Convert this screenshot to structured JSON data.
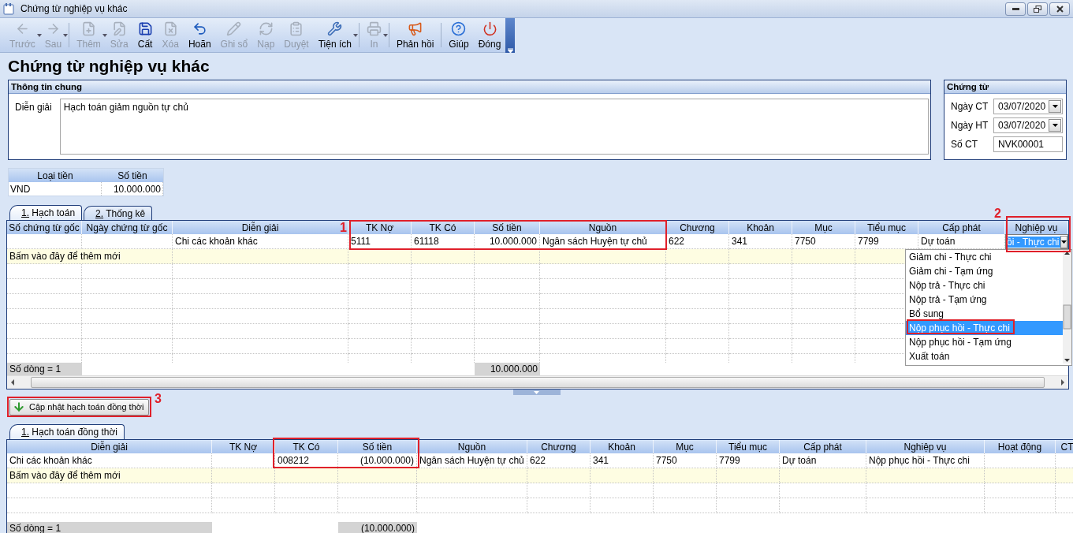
{
  "window": {
    "title": "Chứng từ nghiệp vụ khác"
  },
  "toolbar": [
    {
      "label": "Trước",
      "disabled": true,
      "dropdown": true,
      "group_end": false
    },
    {
      "label": "Sau",
      "disabled": true,
      "dropdown": true,
      "group_end": true
    },
    {
      "label": "Thêm",
      "disabled": true,
      "dropdown": true,
      "group_end": false
    },
    {
      "label": "Sửa",
      "disabled": true,
      "dropdown": false,
      "group_end": false
    },
    {
      "label": "Cất",
      "disabled": false,
      "dropdown": false,
      "group_end": false
    },
    {
      "label": "Xóa",
      "disabled": true,
      "dropdown": false,
      "group_end": false
    },
    {
      "label": "Hoãn",
      "disabled": false,
      "dropdown": false,
      "group_end": false
    },
    {
      "label": "Ghi sổ",
      "disabled": true,
      "dropdown": false,
      "group_end": false
    },
    {
      "label": "Nạp",
      "disabled": true,
      "dropdown": false,
      "group_end": false
    },
    {
      "label": "Duyệt",
      "disabled": true,
      "dropdown": false,
      "group_end": false
    },
    {
      "label": "Tiện ích",
      "disabled": false,
      "dropdown": true,
      "group_end": true
    },
    {
      "label": "In",
      "disabled": true,
      "dropdown": true,
      "group_end": true
    },
    {
      "label": "Phản hồi",
      "disabled": false,
      "dropdown": false,
      "group_end": true
    },
    {
      "label": "Giúp",
      "disabled": false,
      "dropdown": false,
      "group_end": false
    },
    {
      "label": "Đóng",
      "disabled": false,
      "dropdown": false,
      "group_end": false
    }
  ],
  "page_title": "Chứng từ nghiệp vụ khác",
  "general_info": {
    "title": "Thông tin chung",
    "label": "Diễn giải",
    "value": "Hạch toán giảm nguồn tự chủ"
  },
  "voucher": {
    "title": "Chứng từ",
    "fields": [
      {
        "label": "Ngày CT",
        "value": "03/07/2020",
        "kind": "date"
      },
      {
        "label": "Ngày HT",
        "value": "03/07/2020",
        "kind": "date"
      },
      {
        "label": "Số CT",
        "value": "NVK00001",
        "kind": "text"
      }
    ]
  },
  "currency": {
    "columns": [
      "Loại tiền",
      "Số tiền"
    ],
    "rows": [
      [
        "VND",
        "10.000.000"
      ]
    ]
  },
  "tabs": [
    {
      "label": "1. Hạch toán",
      "selected": true
    },
    {
      "label": "2. Thống kê",
      "selected": false
    }
  ],
  "entries": {
    "columns": [
      "Số chứng từ gốc",
      "Ngày chứng từ gốc",
      "Diễn giải",
      "TK Nợ",
      "TK Có",
      "Số tiền",
      "Nguồn",
      "Chương",
      "Khoản",
      "Mục",
      "Tiểu mục",
      "Cấp phát",
      "Nghiệp vụ"
    ],
    "rows": [
      [
        null,
        null,
        "Chi các khoản khác",
        "5111",
        "61118",
        "10.000.000",
        "Ngân sách Huyện tự chủ",
        "622",
        "341",
        "7750",
        "7799",
        "Dự toán",
        {
          "kind": "combo",
          "value": "ồi - Thực chi"
        }
      ]
    ],
    "new_row": "Bấm vào đây để thêm mới",
    "footer": {
      "count": "Số dòng = 1",
      "total": "10.000.000"
    }
  },
  "dropdown": {
    "items": [
      {
        "label": "Giảm chi - Thực chi",
        "selected": false
      },
      {
        "label": "Giảm chi - Tạm ứng",
        "selected": false
      },
      {
        "label": "Nộp trả - Thực chi",
        "selected": false
      },
      {
        "label": "Nộp trả - Tạm ứng",
        "selected": false
      },
      {
        "label": "Bổ sung",
        "selected": false
      },
      {
        "label": "Nộp phục hồi - Thực chi",
        "selected": true
      },
      {
        "label": "Nộp phục hồi - Tạm ứng",
        "selected": false
      },
      {
        "label": "Xuất toán",
        "selected": false
      }
    ]
  },
  "update_button": {
    "label": "Cập nhật hạch toán đồng thời"
  },
  "lower_tabs": [
    {
      "label": "1. Hạch toán đồng thời",
      "selected": true
    }
  ],
  "concurrent": {
    "columns": [
      "Diễn giải",
      "TK Nợ",
      "TK Có",
      "Số tiền",
      "Nguồn",
      "Chương",
      "Khoản",
      "Mục",
      "Tiểu mục",
      "Cấp phát",
      "Nghiệp vụ",
      "Hoạt động",
      "CT"
    ],
    "rows": [
      [
        "Chi các khoản khác",
        null,
        "008212",
        "(10.000.000)",
        "Ngân sách Huyện tự chủ",
        "622",
        "341",
        "7750",
        "7799",
        "Dự toán",
        "Nộp phục hồi - Thực chi",
        null,
        null
      ]
    ],
    "new_row": "Bấm vào đây để thêm mới",
    "footer": {
      "count": "Số dòng = 1",
      "total": "(10.000.000)"
    }
  },
  "annotations": [
    {
      "kind": "numbered",
      "label": "1"
    },
    {
      "kind": "numbered",
      "label": "2"
    },
    {
      "kind": "numbered",
      "label": "3"
    },
    {
      "kind": "plain"
    },
    {
      "kind": "plain"
    }
  ]
}
